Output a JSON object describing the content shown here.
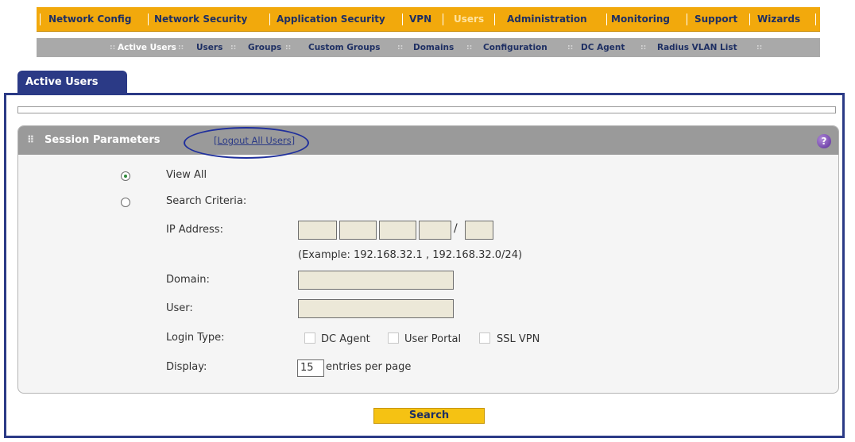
{
  "top_nav": {
    "items": [
      {
        "label": "Network Config"
      },
      {
        "label": "Network Security"
      },
      {
        "label": "Application Security"
      },
      {
        "label": "VPN"
      },
      {
        "label": "Users"
      },
      {
        "label": "Administration"
      },
      {
        "label": "Monitoring"
      },
      {
        "label": "Support"
      },
      {
        "label": "Wizards"
      }
    ],
    "active": "Users"
  },
  "sub_nav": {
    "items": [
      {
        "label": "Active Users"
      },
      {
        "label": "Users"
      },
      {
        "label": "Groups"
      },
      {
        "label": "Custom Groups"
      },
      {
        "label": "Domains"
      },
      {
        "label": "Configuration"
      },
      {
        "label": "DC Agent"
      },
      {
        "label": "Radius VLAN List"
      }
    ],
    "active": "Active Users"
  },
  "tab": {
    "label": "Active Users"
  },
  "panel": {
    "title": "Session Parameters",
    "logout_link": "[Logout All Users]",
    "help_icon": "question-icon"
  },
  "form": {
    "view_all": "View All",
    "search_criteria": "Search Criteria:",
    "ip_address_label": "IP Address:",
    "ip_separator_slash": "/",
    "ip_example": "(Example: 192.168.32.1 , 192.168.32.0/24)",
    "domain_label": "Domain:",
    "user_label": "User:",
    "login_type_label": "Login Type:",
    "login_types": [
      "DC Agent",
      "User Portal",
      "SSL VPN"
    ],
    "display_label": "Display:",
    "display_value": "15",
    "display_suffix": "entries per page"
  },
  "search_button": "Search",
  "colors": {
    "nav_orange": "#f2a90c",
    "nav_text": "#1e2f63",
    "tab_blue": "#2b3a86",
    "panel_header": "#9a9a9a",
    "field_bg": "#ece8d8",
    "button_yellow": "#f5c213"
  }
}
